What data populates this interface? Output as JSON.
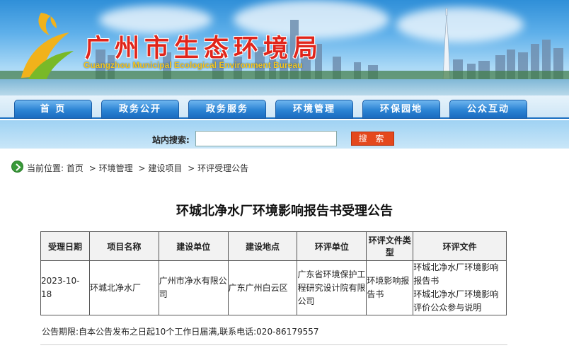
{
  "header": {
    "title": "广州市生态环境局",
    "subtitle": "Guangzhou Municipal Ecological Environment Bureau"
  },
  "nav": {
    "items": [
      {
        "label": "首  页"
      },
      {
        "label": "政务公开"
      },
      {
        "label": "政务服务"
      },
      {
        "label": "环境管理"
      },
      {
        "label": "环保园地"
      },
      {
        "label": "公众互动"
      }
    ]
  },
  "search": {
    "label": "站内搜索:",
    "value": "",
    "button": "搜 索"
  },
  "breadcrumb": {
    "prefix": "当前位置:",
    "items": [
      "首页",
      "环境管理",
      "建设项目",
      "环评受理公告"
    ],
    "separator": ">"
  },
  "article": {
    "title": "环城北净水厂环境影响报告书受理公告",
    "table": {
      "headers": [
        "受理日期",
        "项目名称",
        "建设单位",
        "建设地点",
        "环评单位",
        "环评文件类型",
        "环评文件"
      ],
      "rows": [
        {
          "date": "2023-10-18",
          "project": "环城北净水厂",
          "builder": "广州市净水有限公司",
          "location": "广东广州白云区",
          "eia_unit": "广东省环境保护工程研究设计院有限公司",
          "doc_type": "环境影响报告书",
          "doc_1": "环城北净水厂环境影响报告书",
          "doc_2": "环城北净水厂环境影响评价公众参与说明"
        }
      ]
    },
    "notice": "公告期限:自本公告发布之日起10个工作日届满,联系电话:020-86179557"
  },
  "colors": {
    "title_red": "#e0251b",
    "nav_blue": "#2b83d4",
    "search_button": "#e4481d",
    "breadcrumb_icon": "#3a9a3a"
  }
}
